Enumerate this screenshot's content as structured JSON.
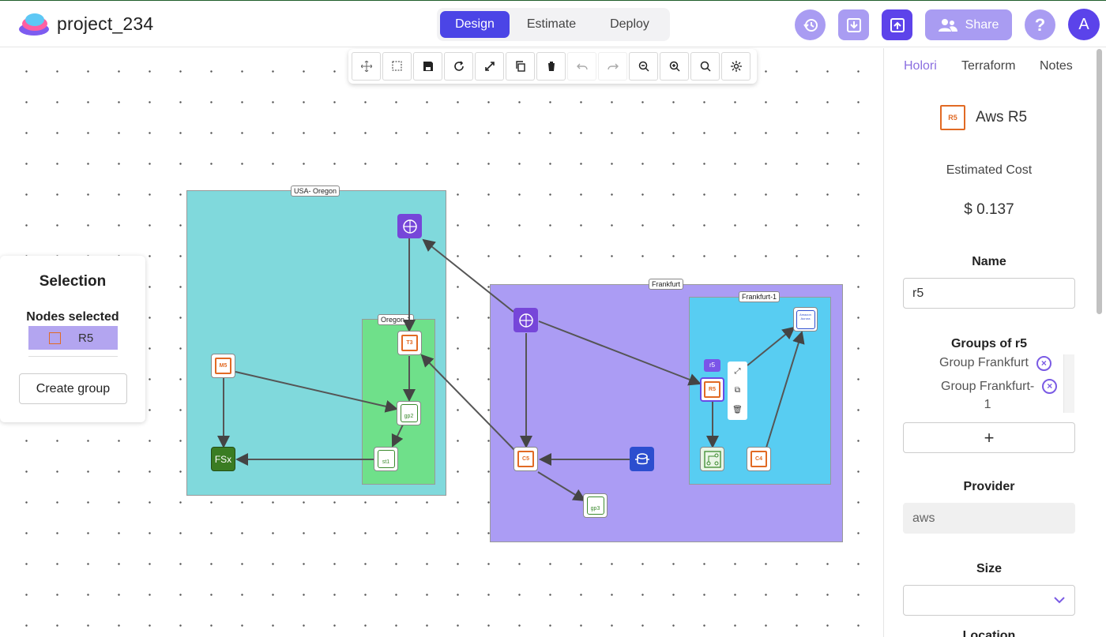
{
  "app": {
    "project_name": "project_234",
    "modes": [
      "Design",
      "Estimate",
      "Deploy"
    ],
    "active_mode": "Design",
    "share_label": "Share",
    "help_label": "?",
    "avatar_initial": "A",
    "accent_color": "#4b45e6"
  },
  "canvas": {
    "groups": [
      {
        "label": "USA- Oregon",
        "color": "#80d9dc"
      },
      {
        "label": "Oregon-1",
        "color": "#6fe08a"
      },
      {
        "label": "Frankfurt",
        "color": "#ab9cf4"
      },
      {
        "label": "Frankfurt-1",
        "color": "#58cdf2"
      }
    ],
    "nodes": {
      "m5": "M5",
      "t3": "T3",
      "gp2": "gp2",
      "st1": "st1",
      "fsx": "FSx",
      "c5": "C5",
      "gp3": "gp3",
      "r5": "R5",
      "c4": "C4",
      "aurora": "Amazon Aurora",
      "r5_tag": "r5"
    }
  },
  "selection_panel": {
    "title": "Selection",
    "subtitle": "Nodes selected",
    "selected_item": "R5",
    "create_group_label": "Create group"
  },
  "right_panel": {
    "tabs": [
      "Holori",
      "Terraform",
      "Notes"
    ],
    "active_tab": "Holori",
    "node_title": "Aws R5",
    "node_icon_label": "R5",
    "estimated_cost_label": "Estimated Cost",
    "estimated_cost_value": "$ 0.137",
    "name_label": "Name",
    "name_value": "r5",
    "groups_label": "Groups of r5",
    "groups": [
      "Group Frankfurt",
      "Group Frankfurt-\n1"
    ],
    "add_label": "+",
    "provider_label": "Provider",
    "provider_value": "aws",
    "size_label": "Size",
    "size_value": "",
    "location_label": "Location"
  }
}
